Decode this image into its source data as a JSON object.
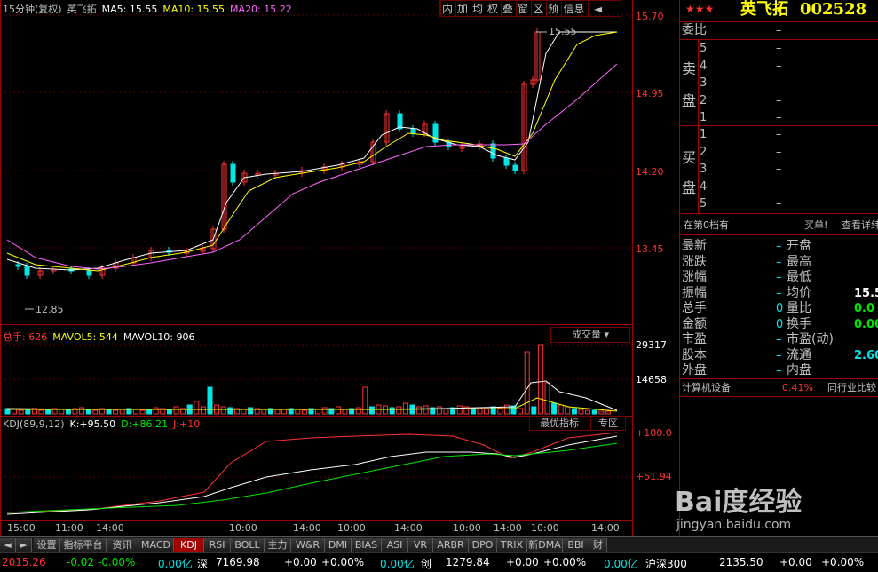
{
  "kline": {
    "period": "15分钟(复权)",
    "name": "英飞拓",
    "ma5_label": "MA5:",
    "ma5_value": "15.55",
    "ma10_label": "MA10:",
    "ma10_value": "15.55",
    "ma20_label": "MA20:",
    "ma20_value": "15.22",
    "high_marker": "15.55",
    "low_marker": "12.85",
    "price_axis": [
      "15.70",
      "14.95",
      "14.20",
      "13.45"
    ]
  },
  "toolbar": [
    "内",
    "加",
    "均",
    "权",
    "叠",
    "窗",
    "区",
    "预",
    "信息",
    "◄"
  ],
  "volume": {
    "label": "总手:",
    "value": "626",
    "mavol5_label": "MAVOL5:",
    "mavol5_value": "544",
    "mavol10_label": "MAVOL10:",
    "mavol10_value": "906",
    "selector": "成交量",
    "axis": [
      "29317",
      "14658"
    ]
  },
  "kdj": {
    "label": "KDJ(89,9,12)",
    "k_label": "K:",
    "k_value": "+95.50",
    "d_label": "D:",
    "d_value": "+86.21",
    "j_label": "J:",
    "j_value": "+10",
    "btn_best": "最优指标",
    "btn_zone": "专区",
    "axis": [
      "+100.0",
      "+51.94"
    ]
  },
  "time_axis": [
    "15:00",
    "11:00",
    "14:00",
    "10:00",
    "14:00",
    "10:00",
    "14:00",
    "10:00",
    "14:00",
    "10:00",
    "14:00",
    "10:00",
    "14:00"
  ],
  "panel": {
    "stars": "★★★",
    "stock_name": "英飞拓",
    "stock_code": "002528",
    "weibi_label": "委比",
    "weibi_value": "–",
    "sell_label_1": "卖",
    "sell_label_2": "盘",
    "buy_label_1": "买",
    "buy_label_2": "盘",
    "sell_levels": [
      "5",
      "4",
      "3",
      "2",
      "1"
    ],
    "buy_levels": [
      "1",
      "2",
      "3",
      "4",
      "5"
    ],
    "level_value": "–",
    "queue_text": "在第0档有",
    "queue_buy": "买单!",
    "queue_detail": "查看详纬",
    "stats": [
      {
        "l": "最新",
        "lv": "–",
        "r": "开盘",
        "rv": ""
      },
      {
        "l": "涨跌",
        "lv": "–",
        "r": "最高",
        "rv": ""
      },
      {
        "l": "涨幅",
        "lv": "–",
        "r": "最低",
        "rv": ""
      },
      {
        "l": "振幅",
        "lv": "–",
        "r": "均价",
        "rv": "15.5"
      },
      {
        "l": "总手",
        "lv": "0",
        "r": "量比",
        "rv": "0.0"
      },
      {
        "l": "金额",
        "lv": "0",
        "r": "换手",
        "rv": "0.00"
      },
      {
        "l": "市盈",
        "lv": "–",
        "r": "市盈(动)",
        "rv": ""
      },
      {
        "l": "股本",
        "lv": "–",
        "r": "流通",
        "rv": "2.60"
      },
      {
        "l": "外盘",
        "lv": "–",
        "r": "内盘",
        "rv": ""
      }
    ],
    "industry": "计算机设备",
    "industry_pct": "0.41%",
    "industry_rank": "同行业比较"
  },
  "tabs": [
    "设置",
    "指标平台",
    "资讯",
    "MACD",
    "KDJ",
    "RSI",
    "BOLL",
    "主力",
    "W&R",
    "DMI",
    "BIAS",
    "ASI",
    "VR",
    "ARBR",
    "DPO",
    "TRIX",
    "新DMA",
    "BBI",
    "财"
  ],
  "active_tab": "KDJ",
  "status": {
    "s1": "2015.26",
    "s2": "-0.02",
    "s3": "-0.00%",
    "s4": "0.00亿",
    "s5": "深",
    "s6": "7169.98",
    "s7": "+0.00",
    "s8": "+0.00%",
    "s9": "0.00亿",
    "s10": "创",
    "s11": "1279.84",
    "s12": "+0.00",
    "s13": "+0.00%",
    "s14": "0.00亿",
    "s15": "沪深300",
    "s16": "2135.50",
    "s17": "+0.00",
    "s18": "+0.00%"
  },
  "watermark": "Bai度经验",
  "watermark_url": "jingyan.baidu.com",
  "colors": {
    "up": "#ff3232",
    "down": "#00e6e6",
    "ma5": "#ffffff",
    "ma10": "#ffff00",
    "ma20": "#ff66ff",
    "grid": "#a00000"
  }
}
